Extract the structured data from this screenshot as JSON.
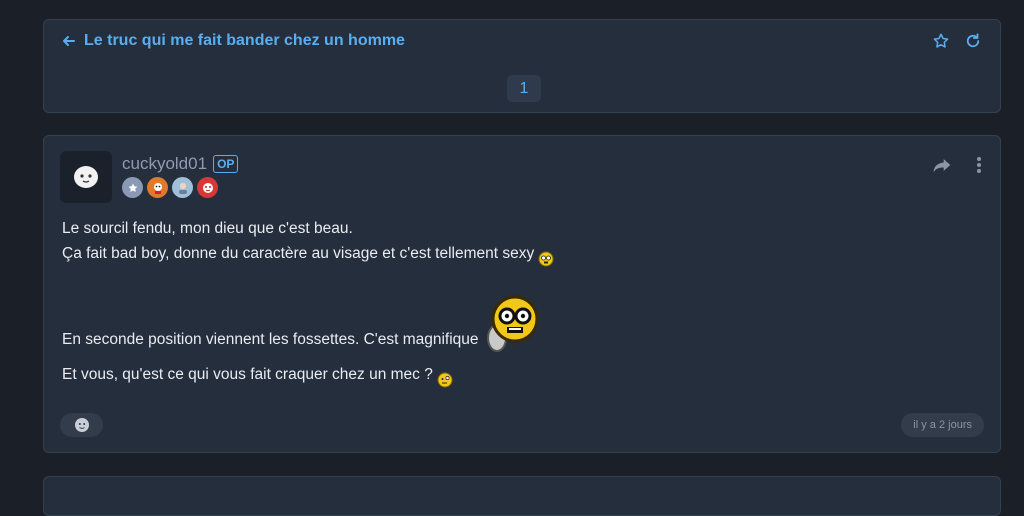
{
  "topic": {
    "title": "Le truc qui me fait bander chez un homme",
    "current_page": "1"
  },
  "post": {
    "author": "cuckyold01",
    "op_label": "OP",
    "badges": [
      {
        "icon": "star-rank-icon",
        "color": "#8a9ab5"
      },
      {
        "icon": "fire-character-icon",
        "color": "#e0792a"
      },
      {
        "icon": "portrait-icon",
        "color": "#9fc0d8"
      },
      {
        "icon": "red-face-icon",
        "color": "#d93636"
      }
    ],
    "lines": [
      "Le sourcil fendu, mon dieu que c'est beau.",
      "Ça fait bad boy, donne du caractère au visage et c'est tellement sexy",
      "En seconde position viennent les fossettes. C'est magnifique",
      "Et vous, qu'est ce qui vous fait craquer chez un mec ?"
    ],
    "timestamp": "il y a 2 jours"
  },
  "colors": {
    "accent": "#5aaeef",
    "card_bg": "#252e3c",
    "page_bg": "#1a1f28"
  }
}
